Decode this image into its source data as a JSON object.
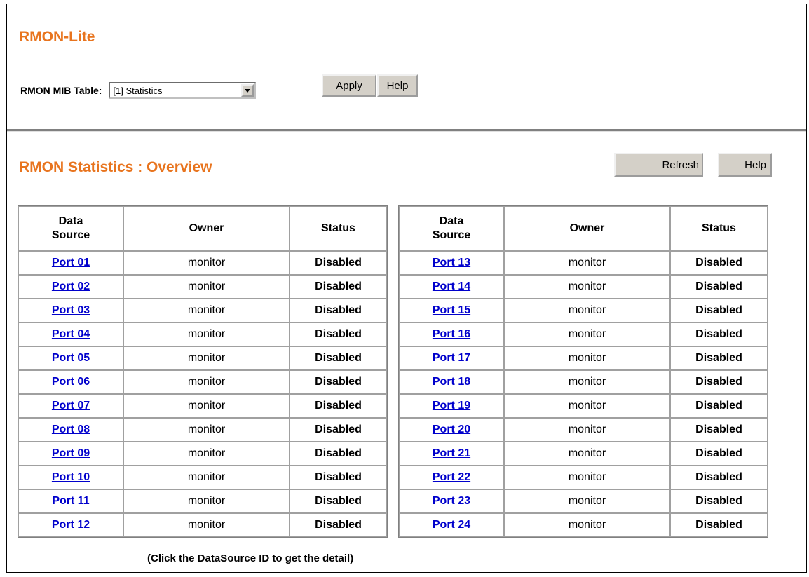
{
  "app": {
    "title": "RMON-Lite"
  },
  "mib_table": {
    "label": "RMON MIB Table:",
    "selected": "[1] Statistics",
    "apply_label": "Apply",
    "help_label": "Help"
  },
  "overview": {
    "title": "RMON Statistics : Overview",
    "refresh_label": "Refresh",
    "help_label": "Help",
    "columns": {
      "data_source_line1": "Data",
      "data_source_line2": "Source",
      "owner": "Owner",
      "status": "Status"
    },
    "left_rows": [
      {
        "port": "Port 01",
        "owner": "monitor",
        "status": "Disabled"
      },
      {
        "port": "Port 02",
        "owner": "monitor",
        "status": "Disabled"
      },
      {
        "port": "Port 03",
        "owner": "monitor",
        "status": "Disabled"
      },
      {
        "port": "Port 04",
        "owner": "monitor",
        "status": "Disabled"
      },
      {
        "port": "Port 05",
        "owner": "monitor",
        "status": "Disabled"
      },
      {
        "port": "Port 06",
        "owner": "monitor",
        "status": "Disabled"
      },
      {
        "port": "Port 07",
        "owner": "monitor",
        "status": "Disabled"
      },
      {
        "port": "Port 08",
        "owner": "monitor",
        "status": "Disabled"
      },
      {
        "port": "Port 09",
        "owner": "monitor",
        "status": "Disabled"
      },
      {
        "port": "Port 10",
        "owner": "monitor",
        "status": "Disabled"
      },
      {
        "port": "Port 11",
        "owner": "monitor",
        "status": "Disabled"
      },
      {
        "port": "Port 12",
        "owner": "monitor",
        "status": "Disabled"
      }
    ],
    "right_rows": [
      {
        "port": "Port 13",
        "owner": "monitor",
        "status": "Disabled"
      },
      {
        "port": "Port 14",
        "owner": "monitor",
        "status": "Disabled"
      },
      {
        "port": "Port 15",
        "owner": "monitor",
        "status": "Disabled"
      },
      {
        "port": "Port 16",
        "owner": "monitor",
        "status": "Disabled"
      },
      {
        "port": "Port 17",
        "owner": "monitor",
        "status": "Disabled"
      },
      {
        "port": "Port 18",
        "owner": "monitor",
        "status": "Disabled"
      },
      {
        "port": "Port 19",
        "owner": "monitor",
        "status": "Disabled"
      },
      {
        "port": "Port 20",
        "owner": "monitor",
        "status": "Disabled"
      },
      {
        "port": "Port 21",
        "owner": "monitor",
        "status": "Disabled"
      },
      {
        "port": "Port 22",
        "owner": "monitor",
        "status": "Disabled"
      },
      {
        "port": "Port 23",
        "owner": "monitor",
        "status": "Disabled"
      },
      {
        "port": "Port 24",
        "owner": "monitor",
        "status": "Disabled"
      }
    ],
    "footer_note": "(Click the DataSource ID to get the detail)"
  },
  "colors": {
    "title_orange": "#e8741e",
    "link_blue": "#0000cc",
    "button_face": "#d4d0c8"
  },
  "icons": {
    "dropdown": "chevron-down-icon"
  }
}
